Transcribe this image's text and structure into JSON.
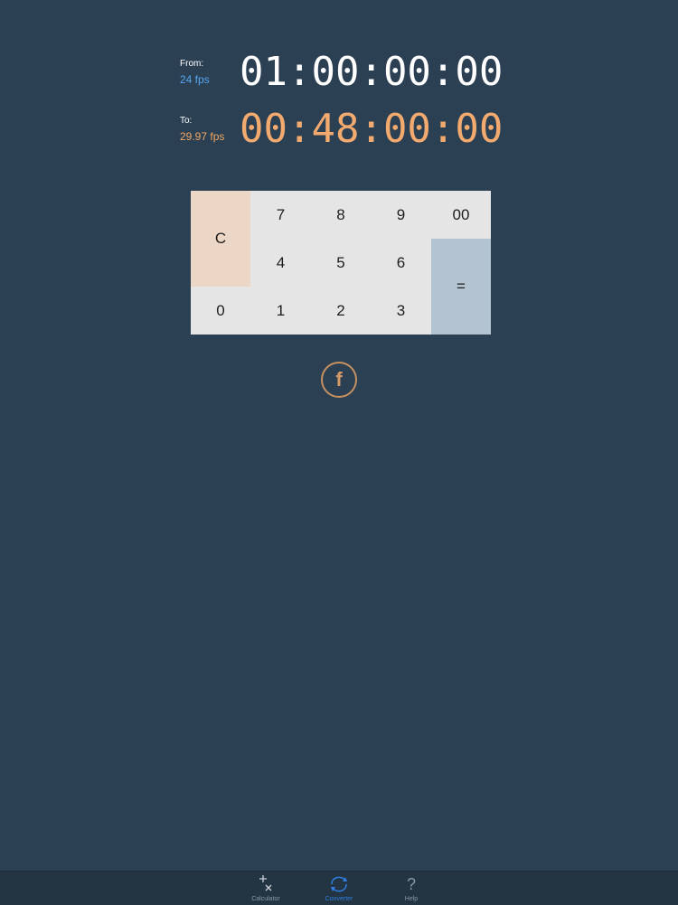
{
  "from": {
    "label": "From:",
    "fps": "24 fps",
    "timecode": "01:00:00:00"
  },
  "to": {
    "label": "To:",
    "fps": "29.97 fps",
    "timecode": "00:48:00:00"
  },
  "keypad": {
    "clear": "C",
    "k7": "7",
    "k8": "8",
    "k9": "9",
    "k00": "00",
    "k4": "4",
    "k5": "5",
    "k6": "6",
    "equals": "=",
    "k0": "0",
    "k1": "1",
    "k2": "2",
    "k3": "3"
  },
  "f_button": {
    "label": "f"
  },
  "tabbar": {
    "calculator": "Calculator",
    "converter": "Converter",
    "help": "Help",
    "help_icon": "?"
  },
  "colors": {
    "background": "#2c4054",
    "from_accent": "#56a6ee",
    "to_accent": "#f2aa6e",
    "tab_active": "#2f7fe0"
  },
  "icons": {
    "calculator_tab": "plus-times-icon",
    "converter_tab": "convert-cycle-icon",
    "help_tab": "question-icon"
  }
}
